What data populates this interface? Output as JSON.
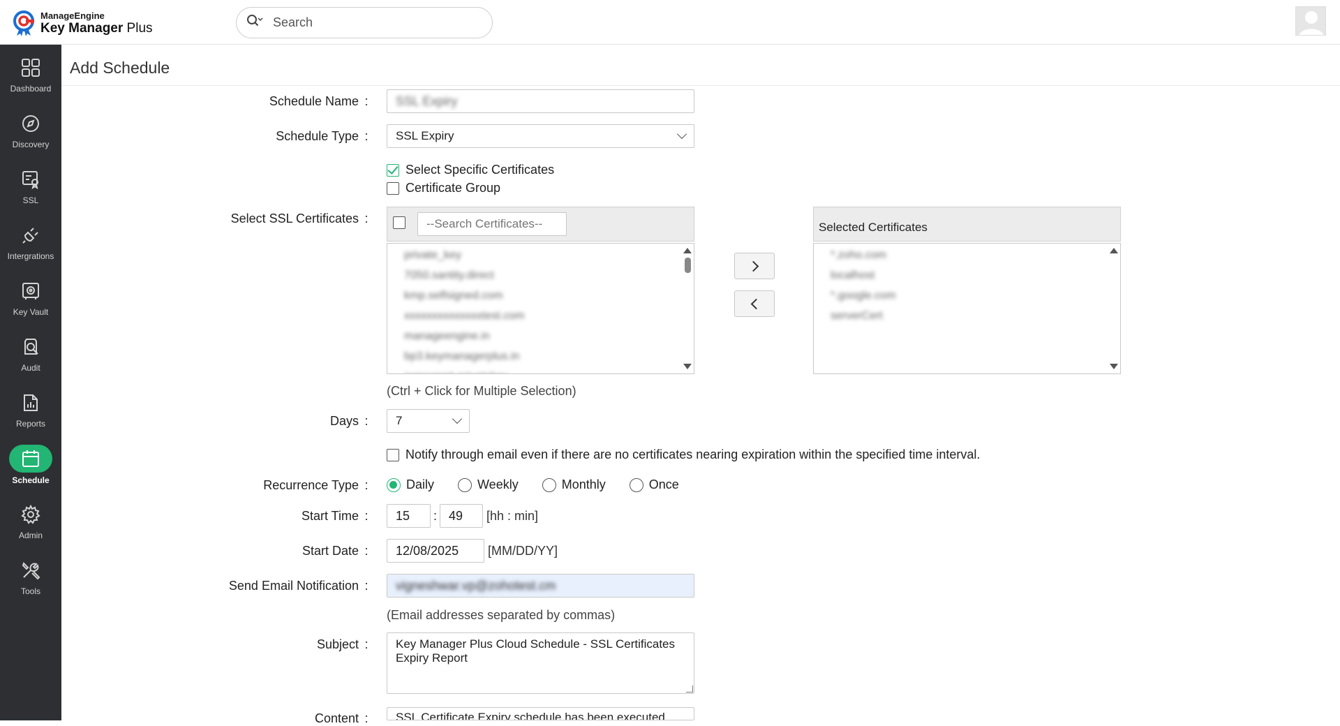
{
  "app": {
    "brand_small": "ManageEngine",
    "brand_name_bold": "Key Manager",
    "brand_name_rest": " Plus",
    "search_placeholder": "Search"
  },
  "sidebar": {
    "items": [
      {
        "label": "Dashboard",
        "icon": "dashboard-icon"
      },
      {
        "label": "Discovery",
        "icon": "compass-icon"
      },
      {
        "label": "SSL",
        "icon": "certificate-icon"
      },
      {
        "label": "Intergrations",
        "icon": "plug-icon"
      },
      {
        "label": "Key Vault",
        "icon": "vault-icon"
      },
      {
        "label": "Audit",
        "icon": "audit-search-icon"
      },
      {
        "label": "Reports",
        "icon": "report-icon"
      },
      {
        "label": "Schedule",
        "icon": "calendar-icon",
        "active": true
      },
      {
        "label": "Admin",
        "icon": "gear-icon"
      },
      {
        "label": "Tools",
        "icon": "tools-icon"
      }
    ],
    "active_color": "#22b573",
    "bg_color": "#2d2f33"
  },
  "page": {
    "title": "Add Schedule"
  },
  "form": {
    "schedule_name": {
      "label": "Schedule Name",
      "value": "SSL Expiry"
    },
    "schedule_type": {
      "label": "Schedule Type",
      "value": "SSL Expiry"
    },
    "select_specific": {
      "label": "Select Specific Certificates",
      "checked": true
    },
    "certificate_group": {
      "label": "Certificate Group",
      "checked": false
    },
    "ssl_certificates": {
      "label": "Select SSL Certificates",
      "search_placeholder": "--Search Certificates--",
      "available": [
        "private_key",
        "7050.santity.direct",
        "kmp.selfsigned.com",
        "xxxxxxxxxxxxxxtest.com",
        "manageengine.in",
        "bp3.keymanagerplus.in",
        "nonexport-privatekey"
      ],
      "selected_title": "Selected Certificates",
      "selected": [
        "*.zoho.com",
        "localhost",
        "*.google.com",
        "serverCert"
      ],
      "hint": "(Ctrl + Click for Multiple Selection)"
    },
    "days": {
      "label": "Days",
      "value": "7"
    },
    "notify": {
      "label": "Notify through email even if there are no certificates nearing expiration within the specified time interval.",
      "checked": false
    },
    "recurrence": {
      "label": "Recurrence Type",
      "options": [
        "Daily",
        "Weekly",
        "Monthly",
        "Once"
      ],
      "selected": "Daily"
    },
    "start_time": {
      "label": "Start Time",
      "hour": "15",
      "minute": "49",
      "separator": ":",
      "hint": "[hh : min]"
    },
    "start_date": {
      "label": "Start Date",
      "value": "12/08/2025",
      "hint": "[MM/DD/YY]"
    },
    "email": {
      "label": "Send Email Notification",
      "value": "vigneshwar.vp@zohotest.cm",
      "hint": "(Email addresses separated by commas)"
    },
    "subject": {
      "label": "Subject",
      "value": "Key Manager Plus Cloud Schedule - SSL Certificates Expiry Report"
    },
    "content": {
      "label": "Content",
      "value": "SSL Certificate Expiry schedule has been executed"
    }
  }
}
